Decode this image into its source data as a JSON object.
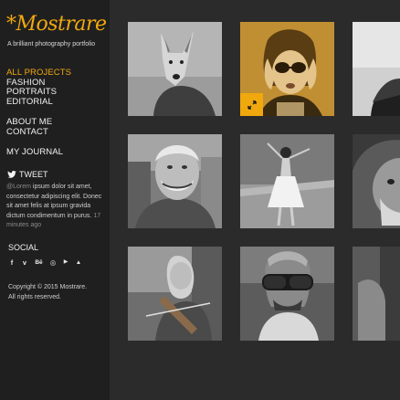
{
  "brand": {
    "logo": "*Mostrare",
    "tagline": "A brilliant photography portfolio"
  },
  "nav": {
    "group1": [
      "ALL PROJECTS",
      "FASHION",
      "PORTRAITS",
      "EDITORIAL"
    ],
    "group2": [
      "ABOUT ME",
      "CONTACT"
    ],
    "group3": [
      "MY JOURNAL"
    ],
    "active": "ALL PROJECTS"
  },
  "tweet": {
    "heading": "TWEET",
    "handle": "@Lorem",
    "text": " ipsum dolor sit amet, consectetur adipiscing elit. Donec sit amet felis at ipsum gravida dictum condimentum in purus.",
    "time": "17 minutes ago"
  },
  "social": {
    "heading": "SOCIAL",
    "icons": [
      {
        "name": "facebook-icon",
        "glyph": "f"
      },
      {
        "name": "vimeo-icon",
        "glyph": "v"
      },
      {
        "name": "behance-icon",
        "glyph": "Bē"
      },
      {
        "name": "dribbble-icon",
        "glyph": "◎"
      },
      {
        "name": "youtube-icon",
        "glyph": "▶"
      },
      {
        "name": "500px-icon",
        "glyph": "▲"
      }
    ]
  },
  "footer": {
    "copyright": "Copyright © 2015 Mostrare.",
    "rights": "All rights reserved."
  },
  "gallery": {
    "items": [
      {
        "name": "photo-fox-mask"
      },
      {
        "name": "photo-woman-sunglasses",
        "highlighted": true
      },
      {
        "name": "photo-man-cropped-1"
      },
      {
        "name": "photo-smiling-old-man"
      },
      {
        "name": "photo-dancing-girl"
      },
      {
        "name": "photo-hooded-old-man"
      },
      {
        "name": "photo-girl-violin"
      },
      {
        "name": "photo-man-goggles"
      },
      {
        "name": "photo-man-cropped-2"
      }
    ]
  },
  "colors": {
    "accent": "#f0a80f",
    "sidebar": "#1f1f1f",
    "main": "#2b2b2b"
  }
}
